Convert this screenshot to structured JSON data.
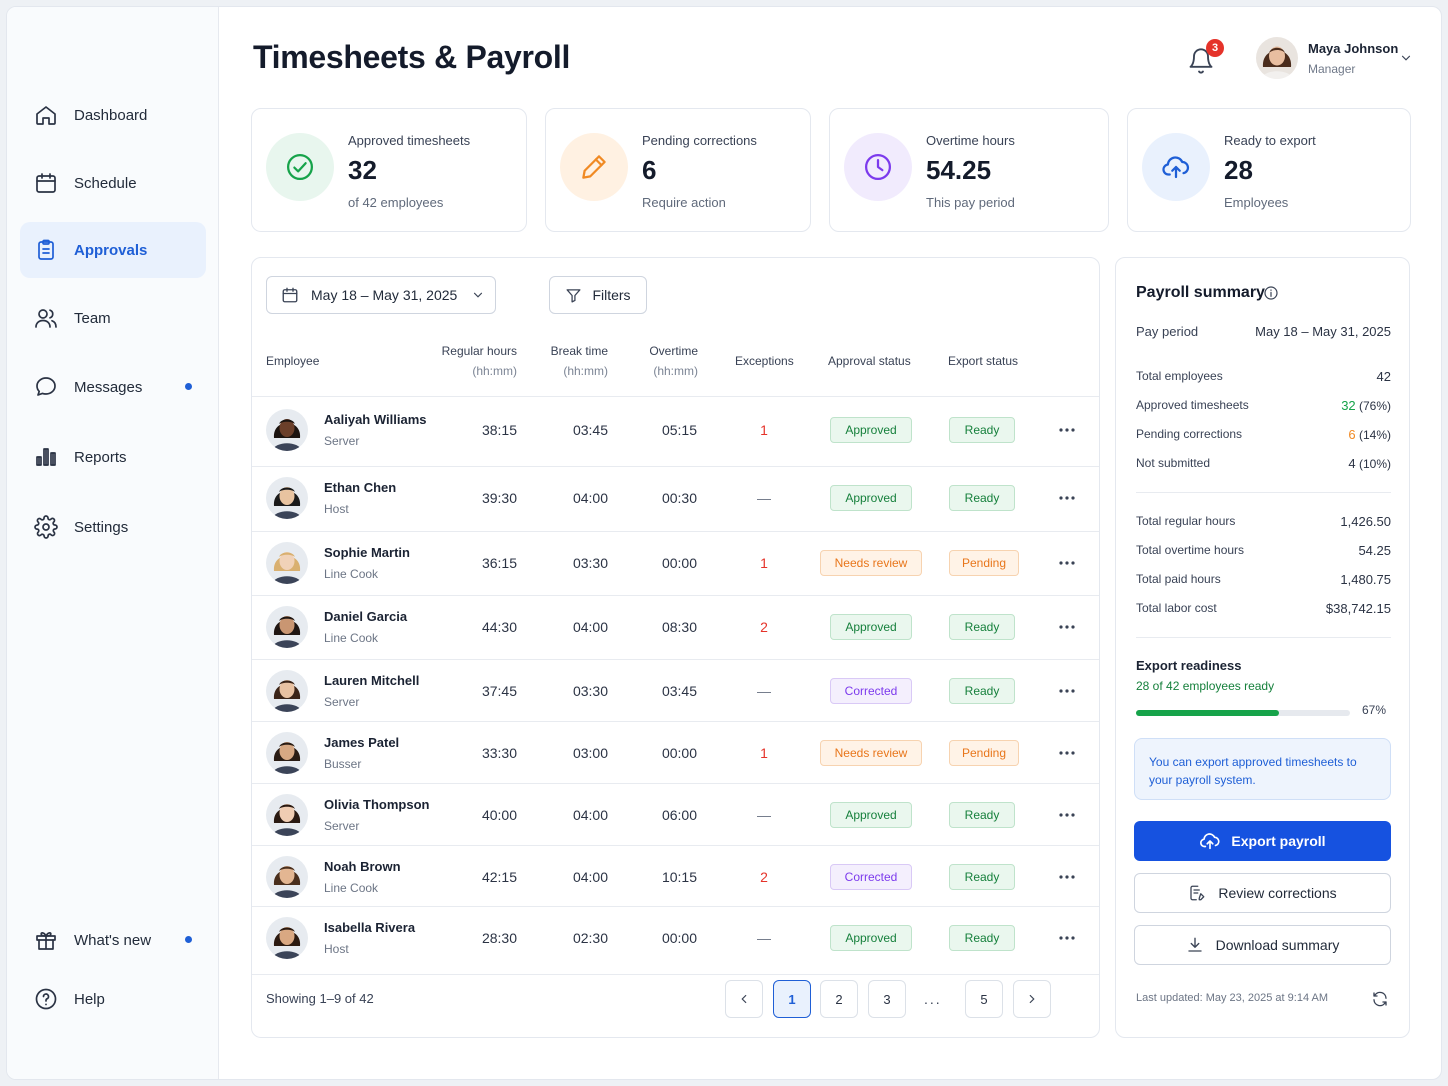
{
  "page": {
    "title": "Timesheets & Payroll"
  },
  "header": {
    "notifications_count": "3",
    "user": {
      "name": "Maya Johnson",
      "role": "Manager"
    }
  },
  "sidebar": {
    "items": [
      {
        "label": "Dashboard",
        "icon": "home-icon"
      },
      {
        "label": "Schedule",
        "icon": "calendar-icon"
      },
      {
        "label": "Approvals",
        "icon": "clipboard-icon",
        "active": true
      },
      {
        "label": "Team",
        "icon": "team-icon"
      },
      {
        "label": "Messages",
        "icon": "chat-icon",
        "dot": true
      },
      {
        "label": "Reports",
        "icon": "bar-chart-icon"
      },
      {
        "label": "Settings",
        "icon": "gear-icon"
      }
    ],
    "bottom": [
      {
        "label": "What's new",
        "icon": "gift-icon",
        "dot": true
      },
      {
        "label": "Help",
        "icon": "help-icon"
      }
    ]
  },
  "stats": [
    {
      "label": "Approved timesheets",
      "value": "32",
      "sub": "of 42 employees",
      "icon": "check-circle-icon",
      "color": "#16a34a",
      "bg": "#e8f6ee"
    },
    {
      "label": "Pending corrections",
      "value": "6",
      "sub": "Require action",
      "icon": "pencil-icon",
      "color": "#f08a24",
      "bg": "#fff1e2"
    },
    {
      "label": "Overtime hours",
      "value": "54.25",
      "sub": "This pay period",
      "icon": "clock-icon",
      "color": "#7c3aed",
      "bg": "#f1ebfd"
    },
    {
      "label": "Ready to export",
      "value": "28",
      "sub": "Employees",
      "icon": "cloud-upload-icon",
      "color": "#1f5fd6",
      "bg": "#e9f1fd"
    }
  ],
  "toolbar": {
    "date_range": "May 18 – May 31, 2025",
    "filters_label": "Filters"
  },
  "table": {
    "headers": {
      "employee": "Employee",
      "regular": "Regular hours",
      "break": "Break time",
      "overtime": "Overtime",
      "unit": "(hh:mm)",
      "exceptions": "Exceptions",
      "approval": "Approval status",
      "export": "Export status"
    },
    "rows": [
      {
        "name": "Aaliyah Williams",
        "role": "Server",
        "regular": "38:15",
        "break": "03:45",
        "overtime": "05:15",
        "exceptions": "1",
        "approval": "Approved",
        "export": "Ready",
        "skin": "#6b3f2a",
        "hair": "#1c1410"
      },
      {
        "name": "Ethan Chen",
        "role": "Host",
        "regular": "39:30",
        "break": "04:00",
        "overtime": "00:30",
        "exceptions": "—",
        "approval": "Approved",
        "export": "Ready",
        "skin": "#e8c3a0",
        "hair": "#1a1a1a"
      },
      {
        "name": "Sophie Martin",
        "role": "Line Cook",
        "regular": "36:15",
        "break": "03:30",
        "overtime": "00:00",
        "exceptions": "1",
        "approval": "Needs review",
        "export": "Pending",
        "skin": "#f1d2b8",
        "hair": "#d9b070"
      },
      {
        "name": "Daniel Garcia",
        "role": "Line Cook",
        "regular": "44:30",
        "break": "04:00",
        "overtime": "08:30",
        "exceptions": "2",
        "approval": "Approved",
        "export": "Ready",
        "skin": "#c99672",
        "hair": "#1f1612"
      },
      {
        "name": "Lauren Mitchell",
        "role": "Server",
        "regular": "37:45",
        "break": "03:30",
        "overtime": "03:45",
        "exceptions": "—",
        "approval": "Corrected",
        "export": "Ready",
        "skin": "#e9c2a2",
        "hair": "#3b2418"
      },
      {
        "name": "James Patel",
        "role": "Busser",
        "regular": "33:30",
        "break": "03:00",
        "overtime": "00:00",
        "exceptions": "1",
        "approval": "Needs review",
        "export": "Pending",
        "skin": "#d7a883",
        "hair": "#2a1c14"
      },
      {
        "name": "Olivia Thompson",
        "role": "Server",
        "regular": "40:00",
        "break": "04:00",
        "overtime": "06:00",
        "exceptions": "—",
        "approval": "Approved",
        "export": "Ready",
        "skin": "#f0cdb3",
        "hair": "#2a1a12"
      },
      {
        "name": "Noah Brown",
        "role": "Line Cook",
        "regular": "42:15",
        "break": "04:00",
        "overtime": "10:15",
        "exceptions": "2",
        "approval": "Corrected",
        "export": "Ready",
        "skin": "#e3b692",
        "hair": "#4a2f1d"
      },
      {
        "name": "Isabella Rivera",
        "role": "Host",
        "regular": "28:30",
        "break": "02:30",
        "overtime": "00:00",
        "exceptions": "—",
        "approval": "Approved",
        "export": "Ready",
        "skin": "#d9a882",
        "hair": "#2b1a10"
      }
    ]
  },
  "status_styles": {
    "Approved": {
      "fg": "#16803c",
      "bg": "#eaf7ee",
      "border": "#bfe3cb"
    },
    "Ready": {
      "fg": "#16803c",
      "bg": "#eaf7ee",
      "border": "#bfe3cb"
    },
    "Needs review": {
      "fg": "#e8761b",
      "bg": "#fff3e7",
      "border": "#f7d3b0"
    },
    "Pending": {
      "fg": "#e8761b",
      "bg": "#fff3e7",
      "border": "#f7d3b0"
    },
    "Corrected": {
      "fg": "#7c3aed",
      "bg": "#f4effd",
      "border": "#d9c9f6"
    }
  },
  "pagination": {
    "showing": "Showing 1–9 of 42",
    "pages": [
      "1",
      "2",
      "3",
      "5"
    ],
    "current": "1",
    "ellipsis": "..."
  },
  "summary": {
    "title": "Payroll summary",
    "pay_period_label": "Pay period",
    "pay_period": "May 18 – May 31, 2025",
    "counts": [
      {
        "label": "Total employees",
        "value": "42",
        "pct": ""
      },
      {
        "label": "Approved timesheets",
        "value": "32",
        "pct": " (76%)",
        "color": "#16a34a"
      },
      {
        "label": "Pending corrections",
        "value": "6",
        "pct": " (14%)",
        "color": "#f08a24"
      },
      {
        "label": "Not submitted",
        "value": "4",
        "pct": " (10%)"
      }
    ],
    "totals": [
      {
        "label": "Total regular hours",
        "value": "1,426.50"
      },
      {
        "label": "Total overtime hours",
        "value": "54.25"
      },
      {
        "label": "Total paid hours",
        "value": "1,480.75"
      },
      {
        "label": "Total labor cost",
        "value": "$38,742.15"
      }
    ],
    "readiness_label": "Export readiness",
    "readiness_sub": "28 of 42 employees ready",
    "readiness_pct_text": "67%",
    "readiness_fraction": 0.67,
    "note": "You can export approved timesheets to your payroll system.",
    "export_label": "Export payroll",
    "review_label": "Review corrections",
    "download_label": "Download summary",
    "updated": "Last updated: May 23, 2025 at 9:14 AM"
  }
}
